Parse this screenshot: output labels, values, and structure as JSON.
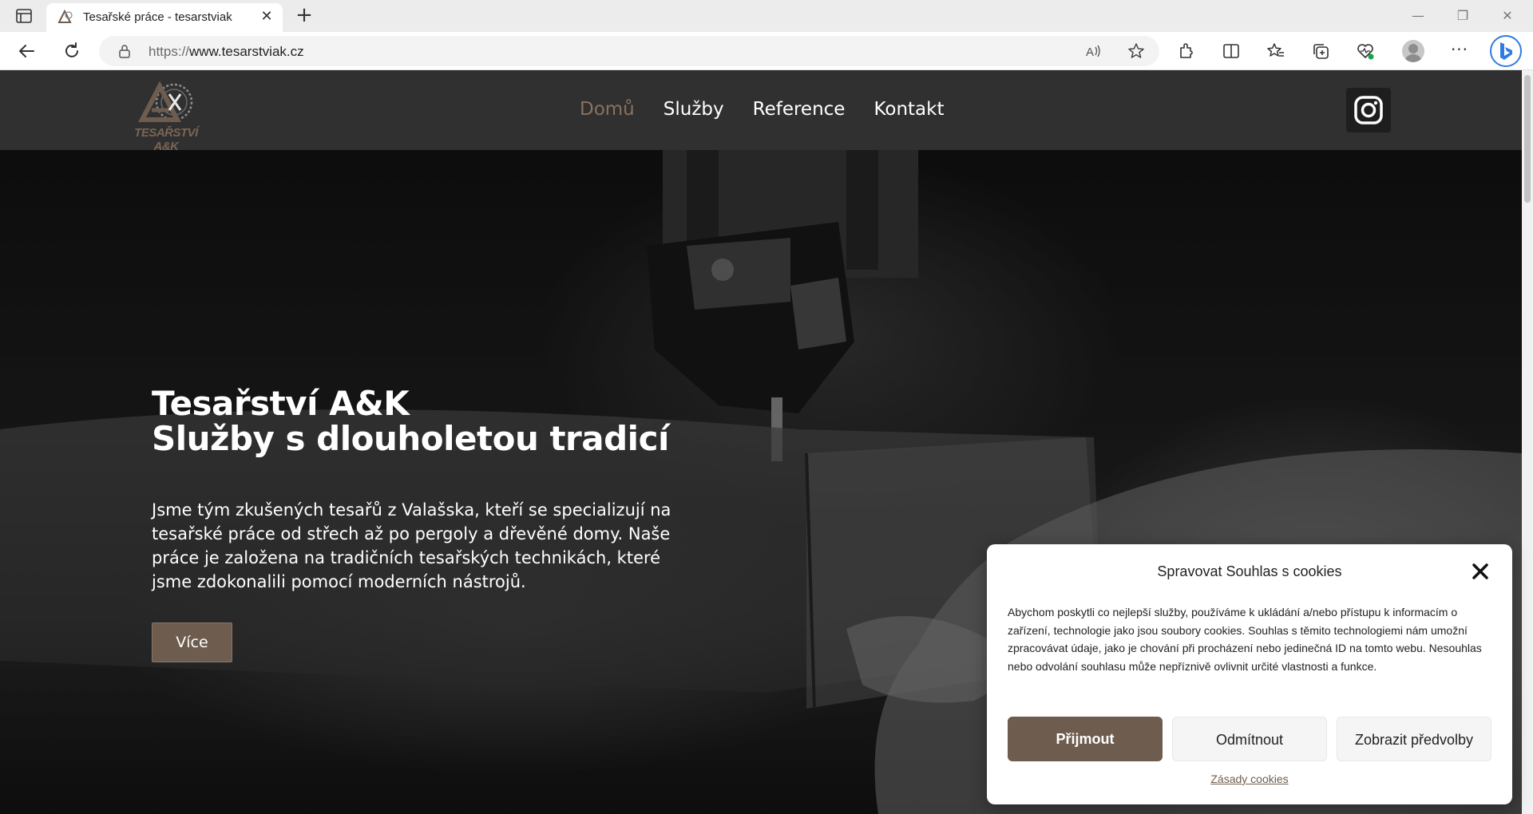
{
  "browser": {
    "tab_title": "Tesařské práce - tesarstviak",
    "url_protocol": "https://",
    "url_host": "www.tesarstviak.cz"
  },
  "site": {
    "logo_text": "TESAŘSTVÍ A&K",
    "nav": [
      {
        "label": "Domů",
        "active": true
      },
      {
        "label": "Služby",
        "active": false
      },
      {
        "label": "Reference",
        "active": false
      },
      {
        "label": "Kontakt",
        "active": false
      }
    ],
    "brand_color": "#6e5d4f",
    "header_color": "#303030"
  },
  "hero": {
    "title_line1": "Tesařství A&K",
    "title_line2": "Služby s dlouholetou tradicí",
    "text": "Jsme tým zkušených tesařů z Valašska, kteří se specializují na tesařské práce od střech až po pergoly a dřevěné domy. Naše práce je založena na tradičních tesařských technikách, které jsme zdokonalili pomocí moderních nástrojů.",
    "button": "Více"
  },
  "cookie": {
    "title": "Spravovat Souhlas s cookies",
    "text": "Abychom poskytli co nejlepší služby, používáme k ukládání a/nebo přístupu k informacím o zařízení, technologie jako jsou soubory cookies. Souhlas s těmito technologiemi nám umožní zpracovávat údaje, jako je chování při procházení nebo jedinečná ID na tomto webu. Nesouhlas nebo odvolání souhlasu může nepříznivě ovlivnit určité vlastnosti a funkce.",
    "accept": "Přijmout",
    "deny": "Odmítnout",
    "preferences": "Zobrazit předvolby",
    "policy_link": "Zásady cookies"
  }
}
